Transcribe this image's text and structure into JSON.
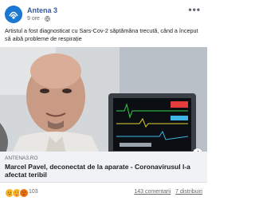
{
  "post": {
    "page_name": "Antena 3",
    "time": "9 ore",
    "more": "•••",
    "text": "Artistul a fost diagnosticat cu Sars-Cov-2 săptămâna trecută, când a început să aibă probleme de respirație"
  },
  "link": {
    "domain": "ANTENA3.RO",
    "title": "Marcel Pavel, deconectat de la aparate - Coronavirusul l-a afectat teribil",
    "info": "i"
  },
  "footer": {
    "reactions": [
      "sad-reaction",
      "care-reaction",
      "angry-reaction"
    ],
    "reaction_count": "103",
    "comments": "143 comentarii",
    "shares": "7 distribuiri"
  },
  "colors": {
    "page_name": "#385898",
    "avatar_bg": "#1a78d2",
    "link_box_bg": "#f0f2f5"
  }
}
